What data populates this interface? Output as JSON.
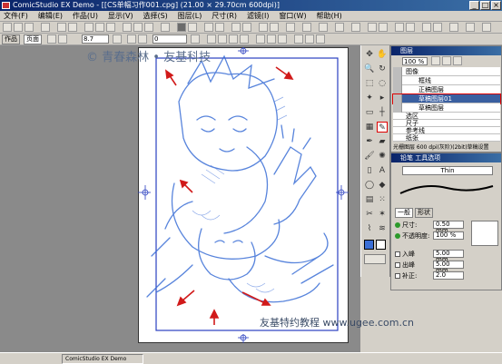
{
  "app": {
    "title": "ComicStudio EX Demo - [[CS单幅习作001.cpg] (21.00 × 29.70cm 600dpi)]"
  },
  "menu": [
    "文件(F)",
    "编辑(E)",
    "作品(U)",
    "显示(V)",
    "选择(S)",
    "图层(L)",
    "尺寸(R)",
    "滤镜(I)",
    "窗口(W)",
    "帮助(H)"
  ],
  "toolbar2": {
    "tab_page": "作品",
    "tab_current": "页面",
    "opacity_value": "8.7",
    "size_value": "0"
  },
  "watermarks": {
    "top": "© 青春森林 • 友基科技",
    "bottom": "友基特约教程 www.ugee.com.cn"
  },
  "layer_panel": {
    "title": "图层",
    "opacity": "100 %",
    "layers": [
      {
        "name": "图像",
        "kind": "group"
      },
      {
        "name": "框线",
        "kind": "layer"
      },
      {
        "name": "正稿图层",
        "kind": "layer"
      },
      {
        "name": "草稿图层01",
        "kind": "layer",
        "selected": true
      },
      {
        "name": "草稿图层",
        "kind": "layer"
      },
      {
        "name": "选区",
        "kind": "group"
      },
      {
        "name": "尺子",
        "kind": "group"
      },
      {
        "name": "参考线",
        "kind": "group"
      },
      {
        "name": "纸张",
        "kind": "group"
      }
    ],
    "status": "光栅图层 600 dpi(灰阶)(2bit)草稿设置"
  },
  "tool_options": {
    "title": "铅笔 工具选项",
    "preset": "Thin",
    "tabs": [
      "一般",
      "形状"
    ],
    "size_label": "尺寸:",
    "size_value": "0.50 mm",
    "opacity_label": "不透明度:",
    "opacity_value": "100 %",
    "in_label": "入峰",
    "in_value": "5.00 mm",
    "out_label": "出峰",
    "out_value": "5.00 mm",
    "correct_label": "补正:",
    "correct_value": "2.0"
  },
  "statusbar": {
    "text": "ComicStudio EX Demo"
  },
  "colors": {
    "title_start": "#0a246a",
    "title_end": "#3a6ea5",
    "sketch_blue": "#3b6fd6",
    "arrow_red": "#d11a1a",
    "guide_blue": "#2a3fc0",
    "selected_layer": "#3a5fa0"
  }
}
